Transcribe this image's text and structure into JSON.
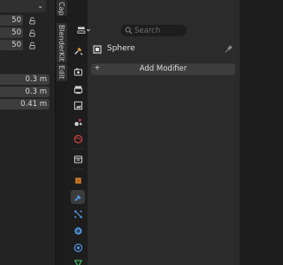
{
  "npanel": {
    "chevron": "⌄",
    "fields": [
      "50",
      "50",
      "50"
    ],
    "dimensions": [
      "0.3 m",
      "0.3 m",
      "0.41 m"
    ]
  },
  "sidebar_tabs": [
    "Cap",
    "BlenderKit",
    "Edit"
  ],
  "properties": {
    "search": {
      "placeholder": "Search",
      "value": ""
    },
    "object_name": "Sphere",
    "add_modifier_label": "Add Modifier",
    "add_modifier_icon": "+",
    "active_tab": "modifiers",
    "tabs": [
      "tool",
      "render",
      "output",
      "view-layer",
      "scene",
      "world",
      "collection",
      "object",
      "modifiers",
      "particles",
      "physics",
      "constraints",
      "data"
    ]
  },
  "colors": {
    "accent_blue": "#4f8fd9",
    "tool_orange": "#e0a040",
    "object_orange": "#d9822b",
    "world_red": "#c84040",
    "data_green": "#40b060"
  }
}
